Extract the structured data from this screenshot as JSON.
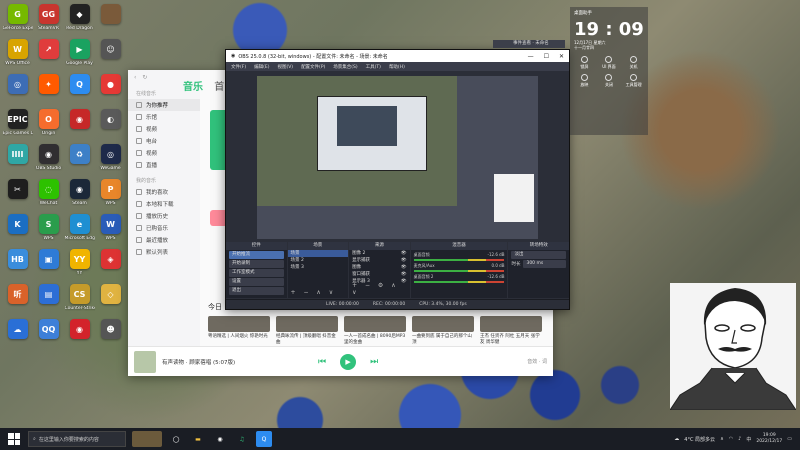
{
  "desktop_icons": [
    {
      "label": "GeForce Experience",
      "color": "#76b900",
      "glyph": "G"
    },
    {
      "label": "SteamVR",
      "color": "#c8352e",
      "glyph": "GG"
    },
    {
      "label": "Red Dragon",
      "color": "#222",
      "glyph": "◆"
    },
    {
      "label": "",
      "color": "#7a5a3a",
      "glyph": ""
    },
    {
      "label": "WPS Office",
      "color": "#d8a400",
      "glyph": "W"
    },
    {
      "label": "",
      "color": "#e03c3c",
      "glyph": "↗"
    },
    {
      "label": "Google Play",
      "color": "#1aa260",
      "glyph": "▶"
    },
    {
      "label": "",
      "color": "#555",
      "glyph": "☺"
    },
    {
      "label": "",
      "color": "#3d6db5",
      "glyph": "◎"
    },
    {
      "label": "",
      "color": "#ff5a00",
      "glyph": "✦"
    },
    {
      "label": "",
      "color": "#2d8cf0",
      "glyph": "Q"
    },
    {
      "label": "",
      "color": "#e53935",
      "glyph": "●"
    },
    {
      "label": "Epic Games Launcher",
      "color": "#222",
      "glyph": "EPIC"
    },
    {
      "label": "Origin",
      "color": "#f56c2d",
      "glyph": "O"
    },
    {
      "label": "",
      "color": "#c62828",
      "glyph": "◉"
    },
    {
      "label": "",
      "color": "#5a5a5a",
      "glyph": "◐"
    },
    {
      "label": "",
      "color": "#2fa7a5",
      "glyph": "IIII"
    },
    {
      "label": "OBS Studio",
      "color": "#302e31",
      "glyph": "◉"
    },
    {
      "label": "",
      "color": "#3d80c7",
      "glyph": "♻"
    },
    {
      "label": "WeGame",
      "color": "#1e2a4a",
      "glyph": "◎"
    },
    {
      "label": "",
      "color": "#1e1e1e",
      "glyph": "✂"
    },
    {
      "label": "WeChat",
      "color": "#2dc100",
      "glyph": "◌"
    },
    {
      "label": "Steam",
      "color": "#1b2838",
      "glyph": "◉"
    },
    {
      "label": "WPS",
      "color": "#e8862a",
      "glyph": "P"
    },
    {
      "label": "",
      "color": "#1b6ec2",
      "glyph": "K"
    },
    {
      "label": "WPS",
      "color": "#2a9d4c",
      "glyph": "S"
    },
    {
      "label": "Microsoft Edge",
      "color": "#1f8fd2",
      "glyph": "e"
    },
    {
      "label": "WPS",
      "color": "#2a5cb8",
      "glyph": "W"
    },
    {
      "label": "",
      "color": "#3a8ddc",
      "glyph": "HB"
    },
    {
      "label": "",
      "color": "#2e7bd6",
      "glyph": "▣"
    },
    {
      "label": "YY",
      "color": "#f0b400",
      "glyph": "YY"
    },
    {
      "label": "",
      "color": "#d33",
      "glyph": "◈"
    },
    {
      "label": "",
      "color": "#d9622a",
      "glyph": "听"
    },
    {
      "label": "",
      "color": "#2c6ed5",
      "glyph": "▤"
    },
    {
      "label": "Counter-Strike",
      "color": "#c59b2a",
      "glyph": "CS"
    },
    {
      "label": "",
      "color": "#e0b341",
      "glyph": "◇"
    },
    {
      "label": "",
      "color": "#2a6fd6",
      "glyph": "☁"
    },
    {
      "label": "",
      "color": "#3d7fd8",
      "glyph": "QQ"
    },
    {
      "label": "",
      "color": "#d3232b",
      "glyph": "◉"
    },
    {
      "label": "",
      "color": "#555",
      "glyph": "☻"
    }
  ],
  "music": {
    "brand": "音乐",
    "tab2": "首",
    "nav_header1": "在线音乐",
    "nav": [
      {
        "label": "为你推荐",
        "active": true
      },
      {
        "label": "乐馆",
        "active": false
      },
      {
        "label": "视频",
        "active": false
      },
      {
        "label": "电台",
        "active": false
      },
      {
        "label": "视频",
        "active": false
      },
      {
        "label": "直播",
        "active": false
      }
    ],
    "nav_header2": "我的音乐",
    "nav_mine": [
      "我的喜欢",
      "本地和下载",
      "播放历史",
      "已购音乐",
      "最近播放",
      "默认列表"
    ],
    "today_label": "今日",
    "cards": [
      "粤语精选 | 人间烟火 惊艳时光",
      "经典咏流传 | 顶级翻唱 抖音金曲",
      "一人一首成名曲 | 8090后MP3里的金曲",
      "一曲要到底 属于自己的那个山顶",
      "王杰 任贤齐 阿杜 五月天 张学友 周华健"
    ],
    "now_playing": "有声读物 · 顾家蓓唱 (5:07版)",
    "extra": "音效 · 词"
  },
  "obs": {
    "title": "OBS 25.0.8 (32-bit, windows) - 配置文件: 未命名 - 场景: 未命名",
    "menu": [
      "文件(F)",
      "编辑(E)",
      "视图(V)",
      "配置文件(P)",
      "场景集合(S)",
      "工具(T)",
      "帮助(H)"
    ],
    "docks": {
      "scenes_title": "场景",
      "scenes": [
        "场景",
        "场景 2",
        "场景 3"
      ],
      "sources_title": "来源",
      "sources": [
        "图像 2",
        "显示捕获",
        "图像",
        "窗口捕获",
        "显示器 3"
      ],
      "mixer_title": "混音器",
      "mixer": [
        {
          "name": "桌面音频",
          "level": "-12.6 dB"
        },
        {
          "name": "麦克风/Aux",
          "level": "0.0 dB"
        },
        {
          "name": "桌面音频 2",
          "level": "-12.6 dB"
        }
      ],
      "transitions_title": "转场特效",
      "transition": "淡出",
      "duration_label": "时长",
      "duration": "300 ms",
      "controls_title": "控件",
      "controls": [
        "开始推流",
        "开始录制",
        "工作室模式",
        "设置",
        "退出"
      ]
    },
    "status": {
      "live": "LIVE: 00:00:00",
      "rec": "REC: 00:00:00",
      "cpu": "CPU: 3.4%, 30.00 fps"
    }
  },
  "tray_popup": "事件查看 · 未命名",
  "clock_widget": {
    "title": "桌面助手",
    "time": "19 : 09",
    "date": "12月17日 星期六",
    "lunar": "十一月廿四",
    "buttons": [
      "锁屏",
      "UI 界面",
      "关机",
      "放映",
      "关闭",
      "工具管理"
    ]
  },
  "taskbar": {
    "search_placeholder": "在这里输入你要搜索的内容",
    "weather": "4°C 局部多云",
    "lang": "中",
    "time": "19:09",
    "date": "2022/12/17"
  }
}
